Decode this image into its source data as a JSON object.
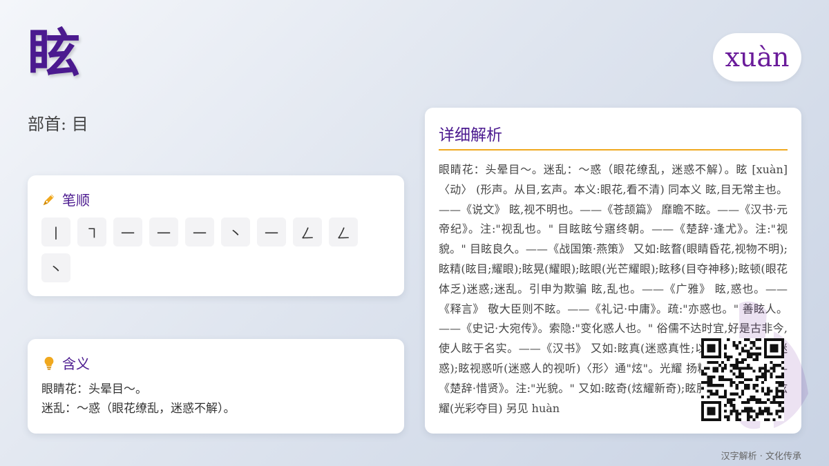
{
  "character": "眩",
  "pinyin": "xuàn",
  "radical_label": "部首: 目",
  "strokes_section": {
    "title": "笔顺",
    "icon": "pen-icon",
    "strokes": [
      "丨",
      "㇕",
      "一",
      "一",
      "一",
      "丶",
      "一",
      "ㄥ",
      "ㄥ",
      "丶"
    ]
  },
  "meaning_section": {
    "title": "含义",
    "icon": "lightbulb-icon",
    "lines": [
      "眼睛花：头晕目～。",
      "迷乱：～惑（眼花缭乱，迷惑不解）。"
    ]
  },
  "detail_section": {
    "title": "详细解析",
    "text": "眼睛花：头晕目～。迷乱：～惑（眼花缭乱，迷惑不解）。眩 [xuàn] 〈动〉 (形声。从目,玄声。本义:眼花,看不清) 同本义 眩,目无常主也。——《说文》 眩,视不明也。——《苍颉篇》 靡瞻不眩。——《汉书·元帝纪》。注:\"视乱也。\" 目眩眩兮寤终朝。——《楚辞·逢尤》。注:\"视貌。\" 目眩良久。——《战国策·燕策》 又如:眩瞀(眼睛昏花,视物不明);眩精(眩目;耀眼);眩晃(耀眼);眩眼(光芒耀眼);眩移(目夺神移);眩顿(眼花体乏)迷惑;迷乱。引申为欺骗 眩,乱也。——《广雅》 眩,惑也。——《释言》 敬大臣则不眩。——《礼记·中庸》。疏:\"亦惑也。\" 善眩人。——《史记·大宛传》。索隐:\"变化惑人也。\" 俗儒不达时宜,好是古非今,使人眩于名实。——《汉书》 又如:眩真(迷惑真性;以假乱真);眩惑(迷惑);眩视惑听(迷惑人的视听)〈形〉通\"炫\"。光耀 扬精华以眩耀。——《楚辞·惜贤》。注:\"光貌。\" 又如:眩奇(炫耀新奇);眩服(华丽的服装);眩耀(光彩夺目) 另见 huàn"
  },
  "footer": "汉字解析 · 文化传承",
  "colors": {
    "accent": "#4b1a8f",
    "underline": "#f0a81e",
    "pen": "#f0a81e",
    "bulb": "#f0a81e"
  }
}
